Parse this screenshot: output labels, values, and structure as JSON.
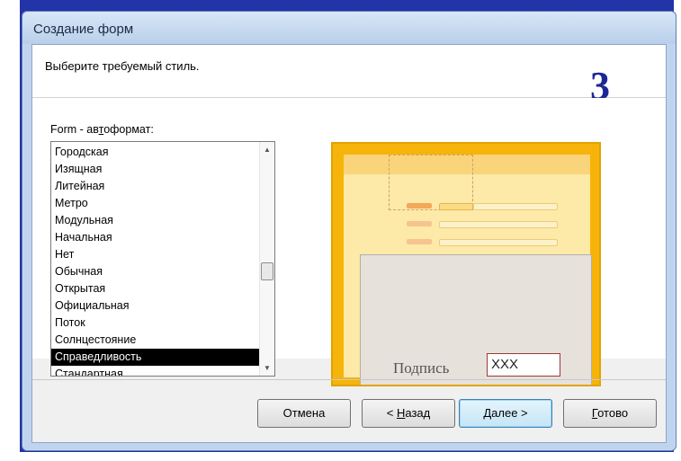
{
  "window": {
    "title": "Создание форм"
  },
  "header": {
    "instruction": "Выберите требуемый стиль.",
    "slide_number": "3"
  },
  "list": {
    "label_before": "Form - ав",
    "label_access": "т",
    "label_after": "оформат:",
    "items": [
      "Городская",
      "Изящная",
      "Литейная",
      "Метро",
      "Модульная",
      "Начальная",
      "Нет",
      "Обычная",
      "Открытая",
      "Официальная",
      "Поток",
      "Солнцестояние",
      "Справедливость",
      "Стандартная"
    ],
    "selected": "Справедливость"
  },
  "preview": {
    "caption": "Подпись",
    "field_value": "XXX"
  },
  "buttons": {
    "cancel": "Отмена",
    "back_prefix": "< ",
    "back_access": "Н",
    "back_rest": "азад",
    "next_access": "Д",
    "next_rest": "алее >",
    "finish_access": "Г",
    "finish_rest": "отово"
  },
  "colors": {
    "accent": "#1c2796",
    "preview_bg": "#f6b40a",
    "selection": "#000000"
  }
}
